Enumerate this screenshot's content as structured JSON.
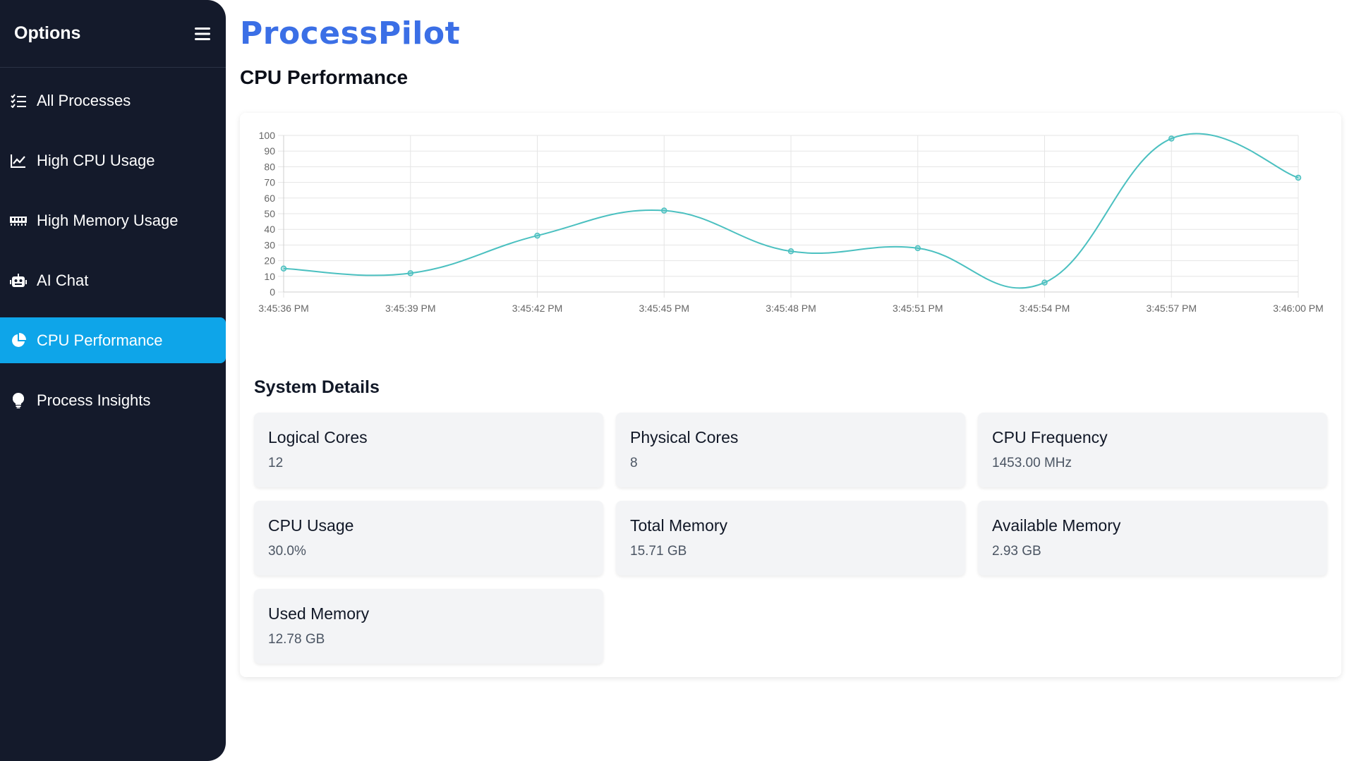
{
  "sidebar": {
    "title": "Options",
    "menu_icon": "hamburger-icon",
    "items": [
      {
        "label": "All Processes",
        "icon": "list-check-icon",
        "active": false
      },
      {
        "label": "High CPU Usage",
        "icon": "chart-line-icon",
        "active": false
      },
      {
        "label": "High Memory Usage",
        "icon": "memory-icon",
        "active": false
      },
      {
        "label": "AI Chat",
        "icon": "robot-icon",
        "active": false
      },
      {
        "label": "CPU Performance",
        "icon": "pie-chart-icon",
        "active": true
      },
      {
        "label": "Process Insights",
        "icon": "lightbulb-icon",
        "active": false
      }
    ]
  },
  "header": {
    "brand": "ProcessPilot",
    "page_title": "CPU Performance"
  },
  "colors": {
    "sidebar_bg": "#141a2b",
    "active_item": "#0ea5e9",
    "brand": "#3b6fe6",
    "line": "#4bc0c0"
  },
  "chart_data": {
    "type": "line",
    "x": [
      "3:45:36 PM",
      "3:45:39 PM",
      "3:45:42 PM",
      "3:45:45 PM",
      "3:45:48 PM",
      "3:45:51 PM",
      "3:45:54 PM",
      "3:45:57 PM",
      "3:46:00 PM"
    ],
    "y": [
      15,
      12,
      36,
      52,
      26,
      28,
      6,
      98,
      73
    ],
    "ylim": [
      0,
      100
    ],
    "yticks": [
      0,
      10,
      20,
      30,
      40,
      50,
      60,
      70,
      80,
      90,
      100
    ],
    "grid": true,
    "legend": false,
    "title": "",
    "xlabel": "",
    "ylabel": ""
  },
  "system": {
    "title": "System Details",
    "tiles": [
      {
        "label": "Logical Cores",
        "value": "12"
      },
      {
        "label": "Physical Cores",
        "value": "8"
      },
      {
        "label": "CPU Frequency",
        "value": "1453.00 MHz"
      },
      {
        "label": "CPU Usage",
        "value": "30.0%"
      },
      {
        "label": "Total Memory",
        "value": "15.71 GB"
      },
      {
        "label": "Available Memory",
        "value": "2.93 GB"
      },
      {
        "label": "Used Memory",
        "value": "12.78 GB"
      }
    ]
  }
}
